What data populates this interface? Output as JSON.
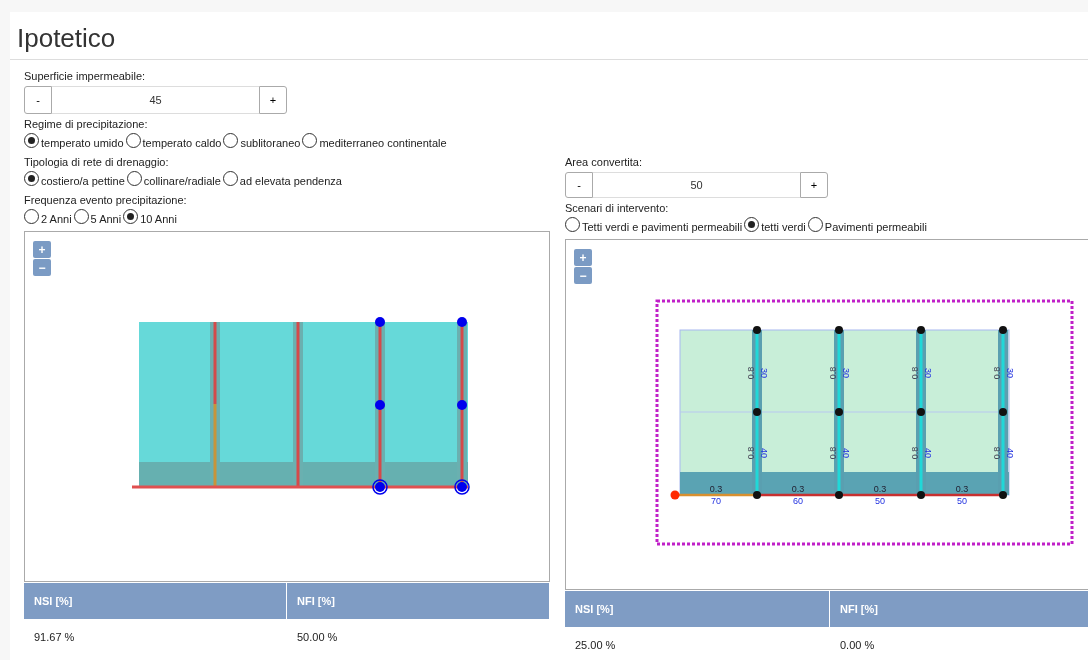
{
  "header": {
    "title": "Ipotetico"
  },
  "left": {
    "spinner": {
      "label": "Superficie impermeabile:",
      "minus": "-",
      "value": "45",
      "plus": "+"
    },
    "radio_groups": [
      {
        "label": "Regime di precipitazione:",
        "options": [
          {
            "label": "temperato umido",
            "selected": true
          },
          {
            "label": "temperato caldo",
            "selected": false
          },
          {
            "label": "sublitoraneo",
            "selected": false
          },
          {
            "label": "mediterraneo continentale",
            "selected": false
          }
        ]
      },
      {
        "label": "Tipologia di rete di drenaggio:",
        "options": [
          {
            "label": "costiero/a pettine",
            "selected": true
          },
          {
            "label": "collinare/radiale",
            "selected": false
          },
          {
            "label": "ad elevata pendenza",
            "selected": false
          }
        ]
      },
      {
        "label": "Frequenza evento precipitazione:",
        "options": [
          {
            "label": "2 Anni",
            "selected": false
          },
          {
            "label": "5 Anni",
            "selected": false
          },
          {
            "label": "10 Anni",
            "selected": true
          }
        ]
      }
    ],
    "map": {
      "kind": "network",
      "zoom_in": "+",
      "zoom_out": "−"
    },
    "table": {
      "columns": [
        "NSI [%]",
        "NFI [%]"
      ],
      "rows": [
        [
          "91.67 %",
          "50.00 %"
        ]
      ]
    }
  },
  "right": {
    "spinner": {
      "label": "Area convertita:",
      "minus": "-",
      "value": "50",
      "plus": "+"
    },
    "radio_groups": [
      {
        "label": "Scenari di intervento:",
        "options": [
          {
            "label": "Tetti verdi e pavimenti permeabili",
            "selected": false
          },
          {
            "label": "tetti verdi",
            "selected": true
          },
          {
            "label": "Pavimenti permeabili",
            "selected": false
          }
        ]
      }
    ],
    "map": {
      "kind": "scenario",
      "zoom_in": "+",
      "zoom_out": "−",
      "links": [
        {
          "upper": [
            "0.8",
            "30"
          ],
          "lower": [
            "0.8",
            "40"
          ]
        },
        {
          "upper": [
            "0.8",
            "30"
          ],
          "lower": [
            "0.8",
            "40"
          ]
        },
        {
          "upper": [
            "0.8",
            "30"
          ],
          "lower": [
            "0.8",
            "40"
          ]
        },
        {
          "upper": [
            "0.8",
            "30"
          ],
          "lower": [
            "0.8",
            "40"
          ]
        }
      ],
      "segments": [
        {
          "coefficient": "0.3",
          "length": "70"
        },
        {
          "coefficient": "0.3",
          "length": "60"
        },
        {
          "coefficient": "0.3",
          "length": "50"
        },
        {
          "coefficient": "0.3",
          "length": "50"
        }
      ]
    },
    "table": {
      "columns": [
        "NSI [%]",
        "NFI [%]"
      ],
      "rows": [
        [
          "25.00 %",
          "0.00 %"
        ]
      ]
    }
  }
}
